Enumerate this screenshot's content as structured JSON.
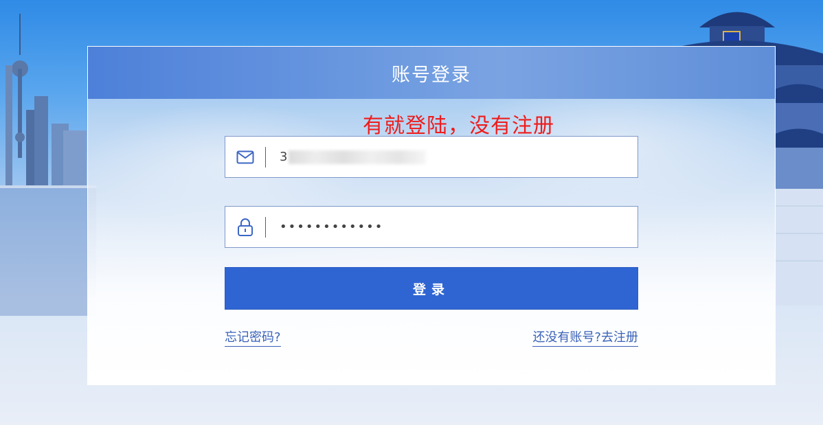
{
  "card": {
    "title": "账号登录",
    "annotation": "有就登陆，没有注册"
  },
  "form": {
    "username": {
      "icon": "mail-icon",
      "value_visible_prefix": "3"
    },
    "password": {
      "icon": "lock-icon",
      "masked_value": "••••••••••••"
    },
    "login_label": "登录",
    "forgot_link": "忘记密码?",
    "register_link": "还没有账号?去注册"
  },
  "colors": {
    "header": "#5b8ad9",
    "button": "#2f65d3",
    "link": "#3a62b8",
    "annotation": "#ee1c1c"
  }
}
